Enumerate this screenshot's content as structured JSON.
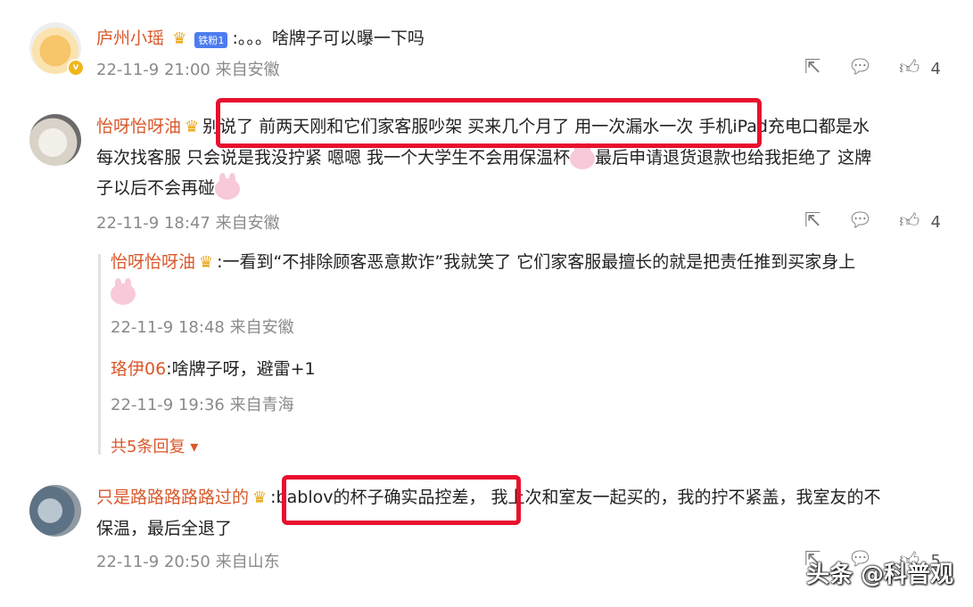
{
  "comments": [
    {
      "user": "庐州小瑶",
      "fan_badge": "铁粉1",
      "text": ":。。。啥牌子可以曝一下吗",
      "time": "22-11-9 21:00 来自安徽",
      "likes": "4"
    },
    {
      "user": "怡呀怡呀油",
      "text_line1": "别说了 前两天刚和它们家客服吵架 买来几个月了 用一次漏水一次 手机iPad充电口都是水",
      "text_line2a": "每次找客服 只会说是我没拧紧 嗯嗯 我一个大学生不会用保温杯",
      "text_line2b": "最后申请退货退款也给我拒绝了 这牌",
      "text_line3": "子以后不会再碰",
      "time": "22-11-9 18:47 来自安徽",
      "likes": "4",
      "replies": [
        {
          "user": "怡呀怡呀油",
          "text": ":一看到“不排除顾客恶意欺诈”我就笑了 它们家客服最擅长的就是把责任推到买家身上",
          "time": "22-11-9 18:48 来自安徽"
        },
        {
          "user": "珞伊06",
          "text": ":啥牌子呀，避雷+1",
          "time": "22-11-9 19:36 来自青海"
        }
      ],
      "more_replies": "共5条回复"
    },
    {
      "user": "只是路路路路路过的",
      "text_line1a": ":bablov的杯子确实品控差，",
      "text_line1b": "我上次和室友一起买的，我的拧不紧盖，我室友的不",
      "text_line2": "保温，最后全退了",
      "time": "22-11-9 20:50 来自山东",
      "likes": "5"
    }
  ],
  "watermark": "头条 @科普观",
  "icons": [
    "share-icon",
    "comment-icon",
    "like-icon",
    "crown-icon",
    "chevron-down-icon"
  ],
  "colors": {
    "username": "#d9582b",
    "highlight": "#e8102e",
    "meta": "#8a8a8a"
  }
}
